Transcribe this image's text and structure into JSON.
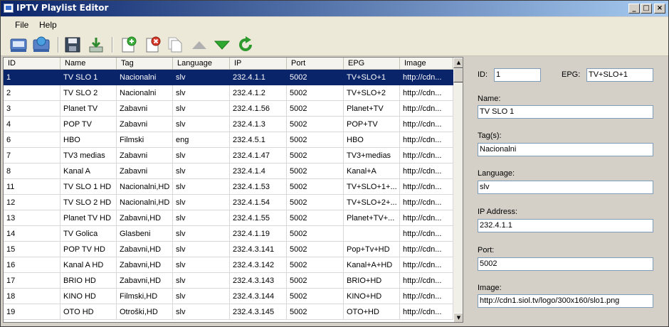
{
  "window": {
    "title": "IPTV Playlist Editor"
  },
  "menu": [
    {
      "label": "File"
    },
    {
      "label": "Help"
    }
  ],
  "toolbar": {
    "buttons": [
      "open-icon",
      "open-url-icon",
      "save-icon",
      "download-icon",
      "add-channel-icon",
      "remove-channel-icon",
      "duplicate-channel-icon",
      "move-up-icon",
      "move-down-icon",
      "refresh-icon"
    ]
  },
  "grid": {
    "columns": [
      "ID",
      "Name",
      "Tag",
      "Language",
      "IP",
      "Port",
      "EPG",
      "Image"
    ],
    "rows": [
      [
        "1",
        "TV SLO 1",
        "Nacionalni",
        "slv",
        "232.4.1.1",
        "5002",
        "TV+SLO+1",
        "http://cdn..."
      ],
      [
        "2",
        "TV SLO 2",
        "Nacionalni",
        "slv",
        "232.4.1.2",
        "5002",
        "TV+SLO+2",
        "http://cdn..."
      ],
      [
        "3",
        "Planet TV",
        "Zabavni",
        "slv",
        "232.4.1.56",
        "5002",
        "Planet+TV",
        "http://cdn..."
      ],
      [
        "4",
        "POP TV",
        "Zabavni",
        "slv",
        "232.4.1.3",
        "5002",
        "POP+TV",
        "http://cdn..."
      ],
      [
        "6",
        "HBO",
        "Filmski",
        "eng",
        "232.4.5.1",
        "5002",
        "HBO",
        "http://cdn..."
      ],
      [
        "7",
        "TV3 medias",
        "Zabavni",
        "slv",
        "232.4.1.47",
        "5002",
        "TV3+medias",
        "http://cdn..."
      ],
      [
        "8",
        "Kanal A",
        "Zabavni",
        "slv",
        "232.4.1.4",
        "5002",
        "Kanal+A",
        "http://cdn..."
      ],
      [
        "11",
        "TV SLO 1 HD",
        "Nacionalni,HD",
        "slv",
        "232.4.1.53",
        "5002",
        "TV+SLO+1+...",
        "http://cdn..."
      ],
      [
        "12",
        "TV SLO 2 HD",
        "Nacionalni,HD",
        "slv",
        "232.4.1.54",
        "5002",
        "TV+SLO+2+...",
        "http://cdn..."
      ],
      [
        "13",
        "Planet TV HD",
        "Zabavni,HD",
        "slv",
        "232.4.1.55",
        "5002",
        "Planet+TV+...",
        "http://cdn..."
      ],
      [
        "14",
        "TV Golica",
        "Glasbeni",
        "slv",
        "232.4.1.19",
        "5002",
        "",
        "http://cdn..."
      ],
      [
        "15",
        "POP TV HD",
        "Zabavni,HD",
        "slv",
        "232.4.3.141",
        "5002",
        "Pop+Tv+HD",
        "http://cdn..."
      ],
      [
        "16",
        "Kanal A HD",
        "Zabavni,HD",
        "slv",
        "232.4.3.142",
        "5002",
        "Kanal+A+HD",
        "http://cdn..."
      ],
      [
        "17",
        "BRIO HD",
        "Zabavni,HD",
        "slv",
        "232.4.3.143",
        "5002",
        "BRIO+HD",
        "http://cdn..."
      ],
      [
        "18",
        "KINO HD",
        "Filmski,HD",
        "slv",
        "232.4.3.144",
        "5002",
        "KINO+HD",
        "http://cdn..."
      ],
      [
        "19",
        "OTO HD",
        "Otroški,HD",
        "slv",
        "232.4.3.145",
        "5002",
        "OTO+HD",
        "http://cdn..."
      ]
    ]
  },
  "details": {
    "id_label": "ID:",
    "id_value": "1",
    "epg_label": "EPG:",
    "epg_value": "TV+SLO+1",
    "name_label": "Name:",
    "name_value": "TV SLO 1",
    "tags_label": "Tag(s):",
    "tags_value": "Nacionalni",
    "language_label": "Language:",
    "language_value": "slv",
    "ip_label": "IP Address:",
    "ip_value": "232.4.1.1",
    "port_label": "Port:",
    "port_value": "5002",
    "image_label": "Image:",
    "image_value": "http://cdn1.siol.tv/logo/300x160/slo1.png"
  },
  "colors": {
    "titlebar_start": "#0a246a",
    "titlebar_end": "#a6caf0",
    "selection": "#0a246a"
  }
}
